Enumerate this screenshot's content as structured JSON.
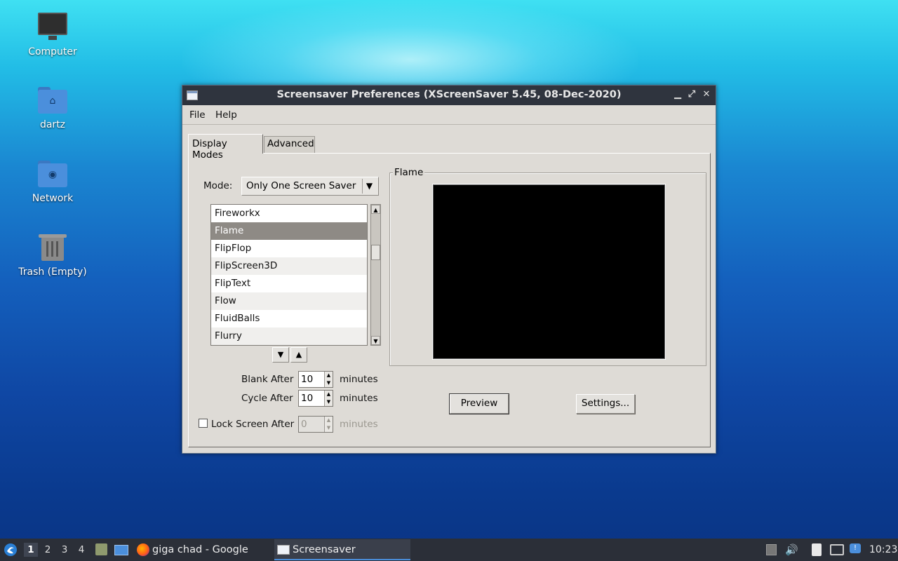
{
  "desktop": {
    "icons": [
      {
        "label": "Computer",
        "icon": "computer-icon"
      },
      {
        "label": "dartz",
        "icon": "home-folder-icon"
      },
      {
        "label": "Network",
        "icon": "network-folder-icon"
      },
      {
        "label": "Trash (Empty)",
        "icon": "trash-icon"
      }
    ]
  },
  "window": {
    "title": "Screensaver Preferences  (XScreenSaver 5.45, 08-Dec-2020)",
    "menu": {
      "file": "File",
      "help": "Help"
    },
    "tabs": [
      {
        "label": "Display Modes",
        "active": true
      },
      {
        "label": "Advanced",
        "active": false
      }
    ],
    "mode": {
      "label": "Mode:",
      "value": "Only One Screen Saver"
    },
    "list": {
      "items": [
        "Fireworkx",
        "Flame",
        "FlipFlop",
        "FlipScreen3D",
        "FlipText",
        "Flow",
        "FluidBalls",
        "Flurry"
      ],
      "selected": "Flame"
    },
    "blank_after": {
      "label": "Blank After",
      "value": "10",
      "unit": "minutes"
    },
    "cycle_after": {
      "label": "Cycle After",
      "value": "10",
      "unit": "minutes"
    },
    "lock_screen": {
      "label": "Lock Screen After",
      "value": "0",
      "unit": "minutes",
      "checked": false
    },
    "preview_frame": {
      "title": "Flame"
    },
    "buttons": {
      "preview": "Preview",
      "settings": "Settings..."
    }
  },
  "taskbar": {
    "workspaces": [
      "1",
      "2",
      "3",
      "4"
    ],
    "active_workspace": "1",
    "tasks": [
      {
        "label": "giga chad - Google Se...",
        "icon": "firefox-icon",
        "active": false
      },
      {
        "label": "Screensaver Preferen...",
        "icon": "window-icon",
        "active": true
      }
    ],
    "clock": "10:23"
  },
  "colors": {
    "titlebar": "#2f343e",
    "window_bg": "#dedbd6",
    "selection": "#8e8a85",
    "taskbar": "#2b2f38",
    "accent": "#4b8fdc"
  }
}
